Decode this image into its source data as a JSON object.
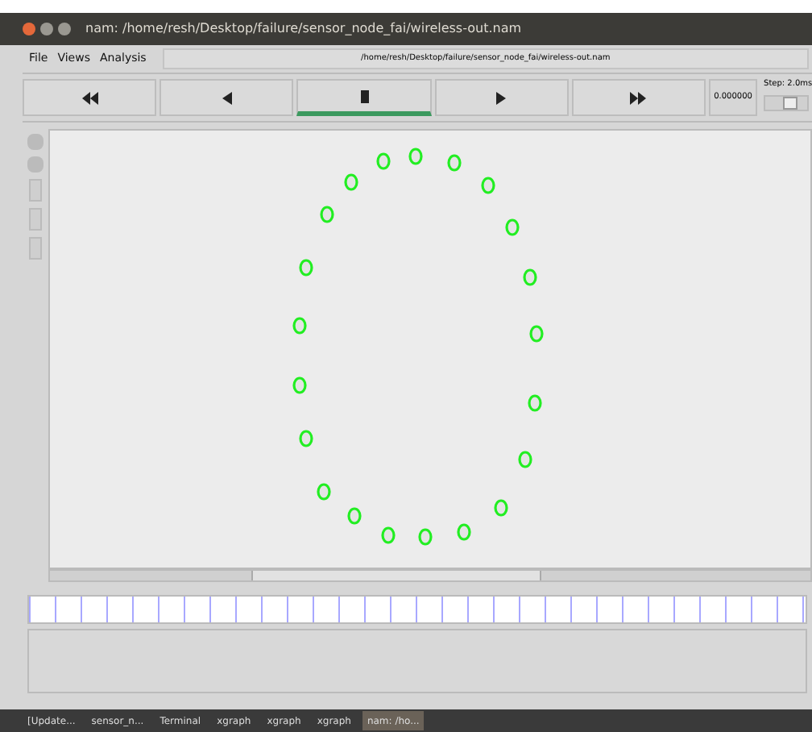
{
  "window": {
    "title": "nam: /home/resh/Desktop/failure/sensor_node_fai/wireless-out.nam"
  },
  "menu": [
    "File",
    "Views",
    "Analysis"
  ],
  "file_path": "/home/resh/Desktop/failure/sensor_node_fai/wireless-out.nam",
  "controls": [
    {
      "kind": "rewind",
      "selected": false
    },
    {
      "kind": "back",
      "selected": false
    },
    {
      "kind": "stop",
      "selected": true
    },
    {
      "kind": "play",
      "selected": false
    },
    {
      "kind": "forward",
      "selected": false
    }
  ],
  "time": "0.000000",
  "step": {
    "label": "Step: 2.0ms",
    "level": 0.6
  },
  "taskbar": [
    {
      "label": "[Update...",
      "selected": false
    },
    {
      "label": "sensor_n...",
      "selected": false
    },
    {
      "label": "Terminal",
      "selected": false
    },
    {
      "label": "xgraph",
      "selected": false
    },
    {
      "label": "xgraph",
      "selected": false
    },
    {
      "label": "xgraph",
      "selected": false
    },
    {
      "label": "nam: /ho...",
      "selected": true
    }
  ]
}
